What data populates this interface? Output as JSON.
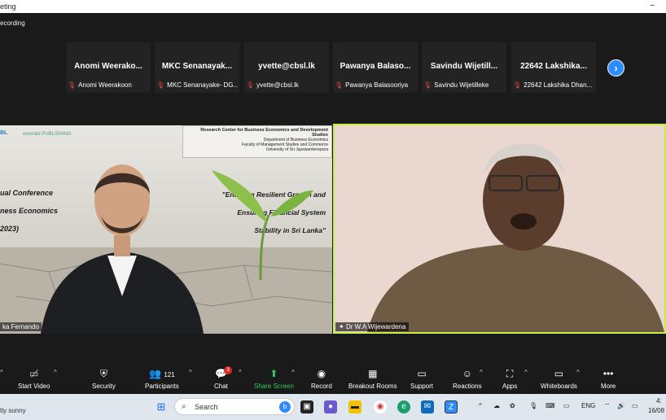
{
  "window": {
    "title": "eting",
    "minimize": "–"
  },
  "recording": "ecording",
  "gallery": {
    "tiles": [
      {
        "name": "Anomi  Weerako...",
        "label": "Anomi Weerakoon"
      },
      {
        "name": "MKC  Senanayak...",
        "label": "MKC Senanayake- DG..."
      },
      {
        "name": "yvette@cbsl.lk",
        "label": "yvette@cbsl.lk"
      },
      {
        "name": "Pawanya  Balaso...",
        "label": "Pawanya Balasooriya"
      },
      {
        "name": "Savindu  Wijetill...",
        "label": "Savindu Wijetilleke"
      },
      {
        "name": "22642  Lakshika...",
        "label": "22642 Lakshika Dhan..."
      }
    ],
    "next": "›"
  },
  "left_video": {
    "logo1": "BL",
    "logo2": "emerald PUBLISHING",
    "banner": [
      "Research Center for Business Economics and Development Studies",
      "Department of Business Economics",
      "Faculty of Management Studies and Commerce",
      "University of Sri Jayewardenepura"
    ],
    "conference": [
      "ual Conference",
      "ness Economics",
      "2023)"
    ],
    "quote": [
      "\"Enabling Resilient Growth and",
      "Ensuring Financial System",
      "Stability in Sri Lanka\""
    ],
    "name_tag": "ka Fernando"
  },
  "right_video": {
    "name_tag": "Dr W.A Wijewardena"
  },
  "toolbar": {
    "start_video": "Start Video",
    "security": "Security",
    "participants": "Participants",
    "participants_count": "121",
    "chat": "Chat",
    "chat_badge": "3",
    "share_screen": "Share Screen",
    "record": "Record",
    "breakout_rooms": "Breakout Rooms",
    "support": "Support",
    "reactions": "Reactions",
    "apps": "Apps",
    "whiteboards": "Whiteboards",
    "more": "More"
  },
  "taskbar": {
    "weather": "tly sunny",
    "search_placeholder": "Search",
    "lang": "ENG",
    "time": "4:",
    "date": "16/08"
  },
  "colors": {
    "active_speaker": "#c6ec4a",
    "share_green": "#2fcd5c",
    "accent_blue": "#2d8cff"
  }
}
